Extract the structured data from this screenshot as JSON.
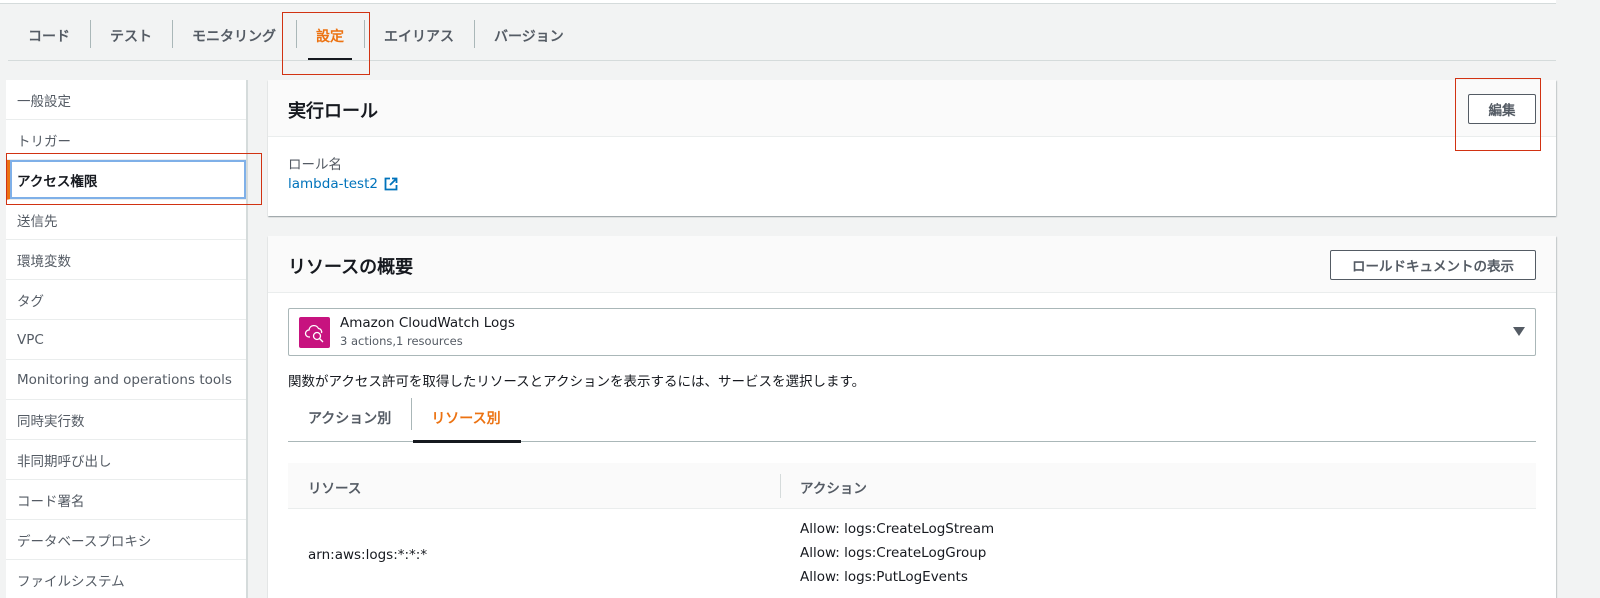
{
  "tabs": [
    {
      "label": "コード",
      "active": false
    },
    {
      "label": "テスト",
      "active": false
    },
    {
      "label": "モニタリング",
      "active": false
    },
    {
      "label": "設定",
      "active": true
    },
    {
      "label": "エイリアス",
      "active": false
    },
    {
      "label": "バージョン",
      "active": false
    }
  ],
  "sidebar": {
    "items": [
      {
        "label": "一般設定"
      },
      {
        "label": "トリガー"
      },
      {
        "label": "アクセス権限"
      },
      {
        "label": "送信先"
      },
      {
        "label": "環境変数"
      },
      {
        "label": "タグ"
      },
      {
        "label": "VPC"
      },
      {
        "label": "Monitoring and operations tools"
      },
      {
        "label": "同時実行数"
      },
      {
        "label": "非同期呼び出し"
      },
      {
        "label": "コード署名"
      },
      {
        "label": "データベースプロキシ"
      },
      {
        "label": "ファイルシステム"
      }
    ]
  },
  "role_panel": {
    "title": "実行ロール",
    "edit_label": "編集",
    "role_label": "ロール名",
    "role_name": "lambda-test2"
  },
  "resource_panel": {
    "title": "リソースの概要",
    "view_doc_label": "ロールドキュメントの表示",
    "service": {
      "name": "Amazon CloudWatch Logs",
      "summary": "3 actions,1 resources",
      "icon": "cloudwatch-logs-icon"
    },
    "description": "関数がアクセス許可を取得したリソースとアクションを表示するには、サービスを選択します。",
    "subtabs": [
      {
        "label": "アクション別",
        "active": false
      },
      {
        "label": "リソース別",
        "active": true
      }
    ],
    "table": {
      "columns": [
        "リソース",
        "アクション"
      ],
      "rows": [
        {
          "resource": "arn:aws:logs:*:*:*",
          "actions": [
            "Allow: logs:CreateLogStream",
            "Allow: logs:CreateLogGroup",
            "Allow: logs:PutLogEvents"
          ]
        }
      ]
    }
  },
  "colors": {
    "accent": "#ec7211",
    "link": "#0073bb",
    "highlight": "#d13212",
    "service_icon": "#c7137f"
  }
}
